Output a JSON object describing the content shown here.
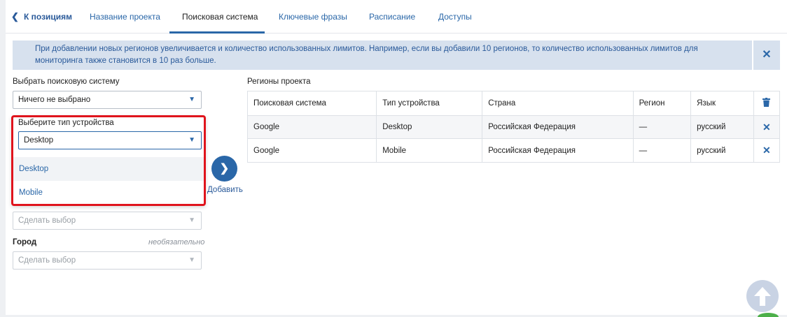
{
  "nav": {
    "back_label": "К позициям",
    "tabs": [
      {
        "label": "Название проекта"
      },
      {
        "label": "Поисковая система"
      },
      {
        "label": "Ключевые фразы"
      },
      {
        "label": "Расписание"
      },
      {
        "label": "Доступы"
      }
    ],
    "active_tab": "Поисковая система"
  },
  "banner": {
    "text": "При добавлении новых регионов увеличивается и количество использованных лимитов. Например, если вы добавили 10 регионов, то количество использованных лимитов для мониторинга также становится в 10 раз больше."
  },
  "form": {
    "search_engine_label": "Выбрать поисковую систему",
    "search_engine_value": "Ничего не выбрано",
    "device_label": "Выберите тип устройства",
    "device_value": "Desktop",
    "device_options": [
      "Desktop",
      "Mobile"
    ],
    "region_placeholder": "Сделать выбор",
    "city_label": "Город",
    "city_optional": "необязательно",
    "city_placeholder": "Сделать выбор",
    "add_label": "Добавить"
  },
  "table": {
    "title": "Регионы проекта",
    "headers": [
      "Поисковая система",
      "Тип устройства",
      "Страна",
      "Регион",
      "Язык"
    ],
    "rows": [
      [
        "Google",
        "Desktop",
        "Российская Федерация",
        "—",
        "русский"
      ],
      [
        "Google",
        "Mobile",
        "Российская Федерация",
        "—",
        "русский"
      ]
    ]
  },
  "colors": {
    "accent": "#2a67a8",
    "highlight_border": "#e0141d",
    "banner_bg": "#d7e1ee"
  },
  "icons": [
    "chevron-left-icon",
    "close-icon",
    "chevron-down-icon",
    "chevron-right-icon",
    "trash-icon",
    "remove-row-icon",
    "arrow-up-icon"
  ]
}
